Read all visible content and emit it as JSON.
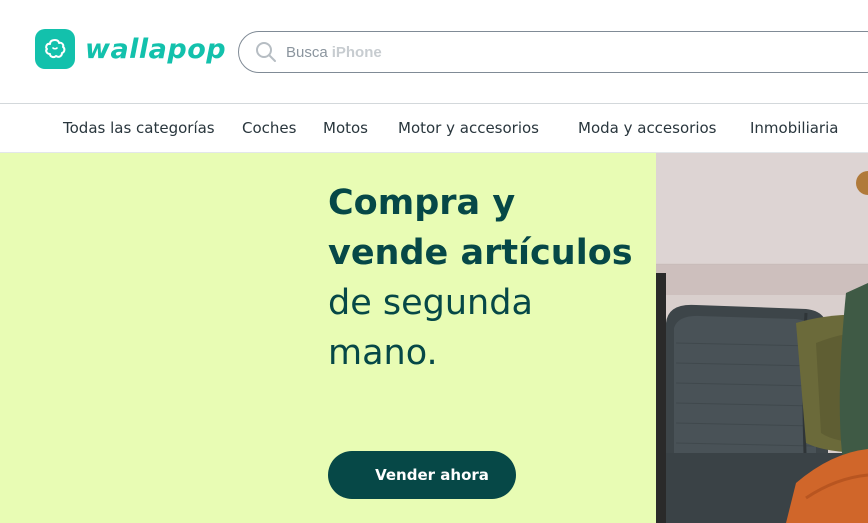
{
  "brand": {
    "name": "wallapop",
    "color": "#13c1ac"
  },
  "search": {
    "placeholder_prefix": "Busca",
    "placeholder_hint": "iPhone"
  },
  "categories": [
    "Todas las categorías",
    "Coches",
    "Motos",
    "Motor y accesorios",
    "Moda y accesorios",
    "Inmobiliaria"
  ],
  "hero": {
    "headline_bold_1": "Compra y",
    "headline_bold_2": "vende artículos",
    "headline_light_1": "de segunda",
    "headline_light_2": "mano.",
    "cta_label": "Vender ahora",
    "background": "#e8fcb4",
    "text_color": "#064847"
  }
}
